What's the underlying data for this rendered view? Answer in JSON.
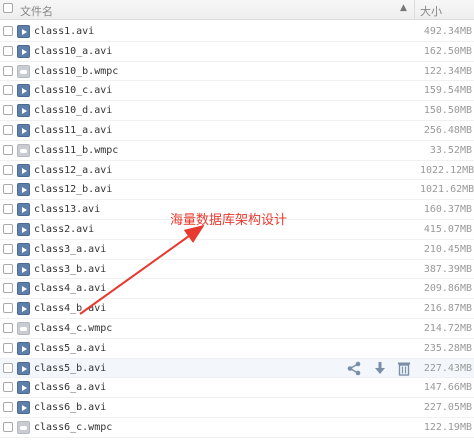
{
  "header": {
    "name_label": "文件名",
    "size_label": "大小",
    "sort_glyph": "▲"
  },
  "files": [
    {
      "name": "class1.avi",
      "size": "492.34MB",
      "type": "video"
    },
    {
      "name": "class10_a.avi",
      "size": "162.50MB",
      "type": "video"
    },
    {
      "name": "class10_b.wmpc",
      "size": "122.34MB",
      "type": "other"
    },
    {
      "name": "class10_c.avi",
      "size": "159.54MB",
      "type": "video"
    },
    {
      "name": "class10_d.avi",
      "size": "150.50MB",
      "type": "video"
    },
    {
      "name": "class11_a.avi",
      "size": "256.48MB",
      "type": "video"
    },
    {
      "name": "class11_b.wmpc",
      "size": "33.52MB",
      "type": "other"
    },
    {
      "name": "class12_a.avi",
      "size": "1022.12MB",
      "type": "video"
    },
    {
      "name": "class12_b.avi",
      "size": "1021.62MB",
      "type": "video"
    },
    {
      "name": "class13.avi",
      "size": "160.37MB",
      "type": "video"
    },
    {
      "name": "class2.avi",
      "size": "415.07MB",
      "type": "video"
    },
    {
      "name": "class3_a.avi",
      "size": "210.45MB",
      "type": "video"
    },
    {
      "name": "class3_b.avi",
      "size": "387.39MB",
      "type": "video"
    },
    {
      "name": "class4_a.avi",
      "size": "209.86MB",
      "type": "video"
    },
    {
      "name": "class4_b.avi",
      "size": "216.87MB",
      "type": "video"
    },
    {
      "name": "class4_c.wmpc",
      "size": "214.72MB",
      "type": "other"
    },
    {
      "name": "class5_a.avi",
      "size": "235.28MB",
      "type": "video"
    },
    {
      "name": "class5_b.avi",
      "size": "227.43MB",
      "type": "video",
      "hovered": true
    },
    {
      "name": "class6_a.avi",
      "size": "147.66MB",
      "type": "video"
    },
    {
      "name": "class6_b.avi",
      "size": "227.05MB",
      "type": "video"
    },
    {
      "name": "class6_c.wmpc",
      "size": "122.19MB",
      "type": "other"
    }
  ],
  "row_actions": {
    "icons": [
      "share-icon",
      "download-icon",
      "trash-icon"
    ]
  },
  "annotation": {
    "text": "海量数据库架构设计",
    "color": "#e8392e"
  },
  "colors": {
    "video_icon": "#5e7fa9",
    "other_icon": "#c9cdd3",
    "hover_row": "#f3f7fc"
  }
}
